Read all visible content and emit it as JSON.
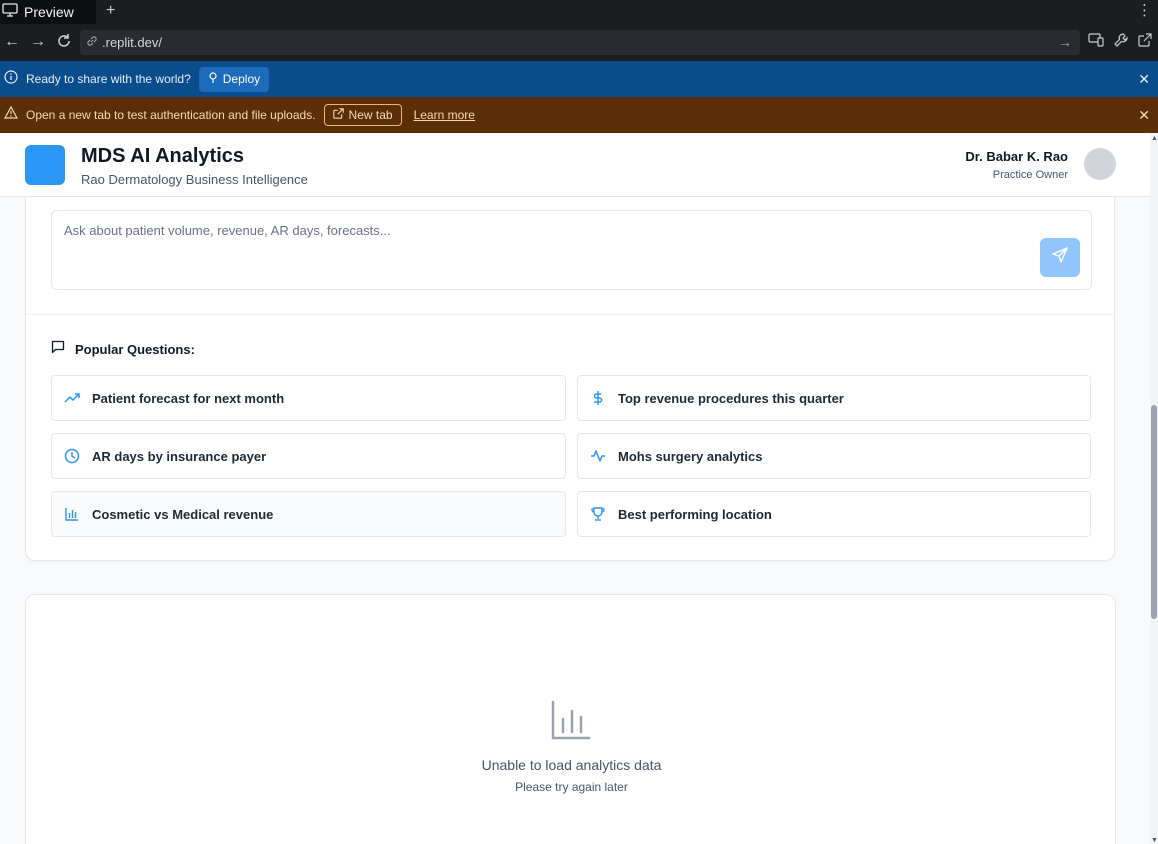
{
  "browser": {
    "tab_label": "Preview",
    "new_tab_symbol": "+",
    "url": ".replit.dev/"
  },
  "deploy_banner": {
    "text": "Ready to share with the world?",
    "button": "Deploy"
  },
  "auth_banner": {
    "text": "Open a new tab to test authentication and file uploads.",
    "new_tab_button": "New tab",
    "learn_more": "Learn more"
  },
  "header": {
    "title": "MDS AI Analytics",
    "subtitle": "Rao Dermatology Business Intelligence",
    "user_name": "Dr. Babar K. Rao",
    "user_role": "Practice Owner"
  },
  "chat": {
    "placeholder": "Ask about patient volume, revenue, AR days, forecasts..."
  },
  "popular": {
    "title": "Popular Questions:",
    "questions": [
      {
        "label": "Patient forecast for next month",
        "icon": "trending-up-icon"
      },
      {
        "label": "Top revenue procedures this quarter",
        "icon": "dollar-icon"
      },
      {
        "label": "AR days by insurance payer",
        "icon": "clock-icon"
      },
      {
        "label": "Mohs surgery analytics",
        "icon": "activity-icon"
      },
      {
        "label": "Cosmetic vs Medical revenue",
        "icon": "bar-chart-icon"
      },
      {
        "label": "Best performing location",
        "icon": "trophy-icon"
      }
    ]
  },
  "analytics": {
    "error_title": "Unable to load analytics data",
    "error_subtitle": "Please try again later"
  },
  "colors": {
    "accent": "#2b96f3",
    "send_button": "#93c5fd",
    "deploy_banner": "#0a4d8c",
    "auth_banner": "#5b2e07"
  }
}
